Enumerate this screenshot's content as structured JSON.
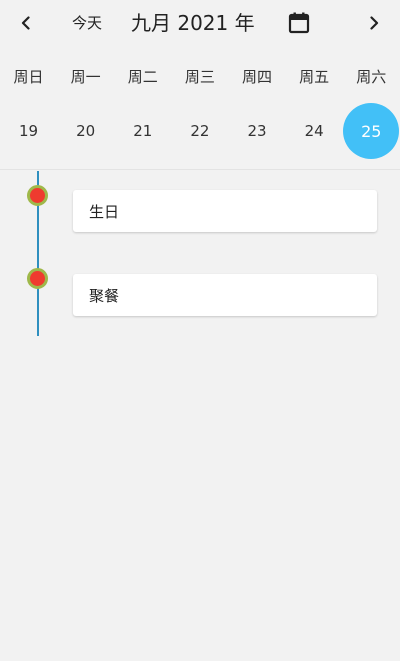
{
  "header": {
    "prev_icon": "chevron-left-icon",
    "today_label": "今天",
    "month_title": "九月 2021 年",
    "calendar_icon": "calendar-icon",
    "next_icon": "chevron-right-icon"
  },
  "week": {
    "weekdays": [
      "周日",
      "周一",
      "周二",
      "周三",
      "周四",
      "周五",
      "周六"
    ],
    "dates": [
      "19",
      "20",
      "21",
      "22",
      "23",
      "24",
      "25"
    ],
    "selected_date": "25",
    "selected_color": "#42c0f7"
  },
  "timeline": {
    "line_color": "#2f8fbf",
    "dot_color": "#ef3b2f",
    "dot_border_color": "#9fb84a",
    "events": [
      {
        "title": "生日"
      },
      {
        "title": "聚餐"
      }
    ]
  }
}
